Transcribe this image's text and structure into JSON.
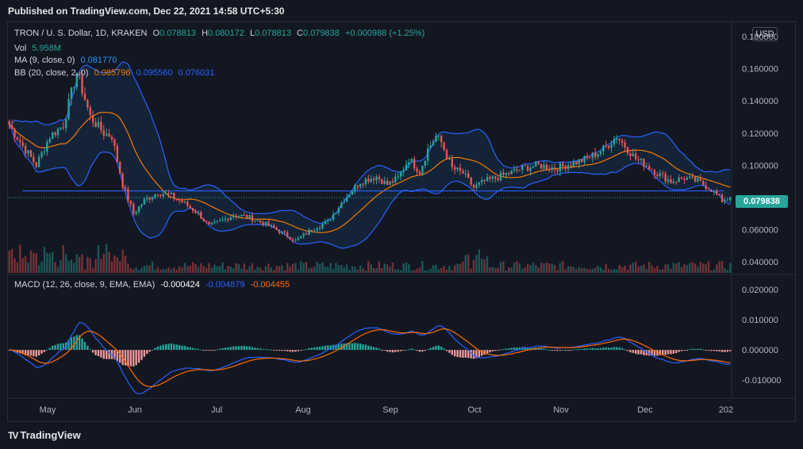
{
  "header": {
    "published": "Published on TradingView.com, Dec 22, 2021 14:58 UTC+5:30"
  },
  "footer": {
    "brand": "TradingView",
    "logo_icon": "TV"
  },
  "legend": {
    "symbol": "TRON / U. S. Dollar, 1D, KRAKEN",
    "o_label": "O",
    "o_val": "0.078813",
    "h_label": "H",
    "h_val": "0.080172",
    "l_label": "L",
    "l_val": "0.078813",
    "c_label": "C",
    "c_val": "0.079838",
    "change": "+0.000988 (+1.25%)",
    "vol_label": "Vol",
    "vol_val": "5.958M",
    "ma_label": "MA (9, close, 0)",
    "ma_val": "0.081770",
    "bb_label": "BB (20, close, 2, 0)",
    "bb_mid": "0.085796",
    "bb_up": "0.095560",
    "bb_low": "0.076031",
    "macd_label": "MACD (12, 26, close, 9, EMA, EMA)",
    "macd_hist": "-0.000424",
    "macd_line": "-0.004879",
    "macd_signal": "-0.004455"
  },
  "currency": "USD",
  "last_price": "0.079838",
  "colors": {
    "up": "#26a69a",
    "down": "#ef5350",
    "bb": "#2962ff",
    "ma": "#f57c00",
    "macd": "#2962ff",
    "signal": "#ff6d00",
    "hline": "#2962ff"
  },
  "chart_data": [
    {
      "type": "candlestick",
      "title": "TRON / U. S. Dollar, 1D, KRAKEN",
      "ylim": [
        0.033,
        0.188
      ],
      "y_ticks": [
        "0.180000",
        "0.160000",
        "0.140000",
        "0.120000",
        "0.100000",
        "0.080000",
        "0.060000",
        "0.040000"
      ],
      "x_ticks": [
        "May",
        "Jun",
        "Jul",
        "Aug",
        "Sep",
        "Oct",
        "Nov",
        "Dec",
        "202"
      ],
      "horizontal_line": 0.084,
      "close_keypoints": [
        {
          "d": 0,
          "v": 0.125
        },
        {
          "d": 5,
          "v": 0.112
        },
        {
          "d": 10,
          "v": 0.1
        },
        {
          "d": 15,
          "v": 0.118
        },
        {
          "d": 20,
          "v": 0.125
        },
        {
          "d": 25,
          "v": 0.158
        },
        {
          "d": 30,
          "v": 0.13
        },
        {
          "d": 35,
          "v": 0.12
        },
        {
          "d": 38,
          "v": 0.118
        },
        {
          "d": 42,
          "v": 0.088
        },
        {
          "d": 46,
          "v": 0.07
        },
        {
          "d": 50,
          "v": 0.078
        },
        {
          "d": 55,
          "v": 0.083
        },
        {
          "d": 60,
          "v": 0.081
        },
        {
          "d": 65,
          "v": 0.076
        },
        {
          "d": 70,
          "v": 0.07
        },
        {
          "d": 74,
          "v": 0.062
        },
        {
          "d": 78,
          "v": 0.065
        },
        {
          "d": 83,
          "v": 0.069
        },
        {
          "d": 88,
          "v": 0.068
        },
        {
          "d": 94,
          "v": 0.064
        },
        {
          "d": 100,
          "v": 0.059
        },
        {
          "d": 106,
          "v": 0.053
        },
        {
          "d": 112,
          "v": 0.06
        },
        {
          "d": 118,
          "v": 0.065
        },
        {
          "d": 124,
          "v": 0.079
        },
        {
          "d": 130,
          "v": 0.09
        },
        {
          "d": 136,
          "v": 0.093
        },
        {
          "d": 140,
          "v": 0.088
        },
        {
          "d": 144,
          "v": 0.092
        },
        {
          "d": 148,
          "v": 0.104
        },
        {
          "d": 152,
          "v": 0.096
        },
        {
          "d": 155,
          "v": 0.11
        },
        {
          "d": 158,
          "v": 0.118
        },
        {
          "d": 160,
          "v": 0.114
        },
        {
          "d": 164,
          "v": 0.098
        },
        {
          "d": 168,
          "v": 0.095
        },
        {
          "d": 172,
          "v": 0.086
        },
        {
          "d": 176,
          "v": 0.09
        },
        {
          "d": 180,
          "v": 0.092
        },
        {
          "d": 185,
          "v": 0.095
        },
        {
          "d": 190,
          "v": 0.098
        },
        {
          "d": 196,
          "v": 0.1
        },
        {
          "d": 202,
          "v": 0.098
        },
        {
          "d": 208,
          "v": 0.101
        },
        {
          "d": 214,
          "v": 0.104
        },
        {
          "d": 220,
          "v": 0.11
        },
        {
          "d": 225,
          "v": 0.118
        },
        {
          "d": 228,
          "v": 0.112
        },
        {
          "d": 232,
          "v": 0.104
        },
        {
          "d": 236,
          "v": 0.1
        },
        {
          "d": 240,
          "v": 0.095
        },
        {
          "d": 245,
          "v": 0.09
        },
        {
          "d": 250,
          "v": 0.092
        },
        {
          "d": 255,
          "v": 0.09
        },
        {
          "d": 260,
          "v": 0.085
        },
        {
          "d": 264,
          "v": 0.078
        },
        {
          "d": 267,
          "v": 0.0798
        }
      ]
    },
    {
      "type": "line",
      "title": "MACD (12, 26, close, 9, EMA, EMA)",
      "ylim": [
        -0.0155,
        0.0245
      ],
      "y_ticks": [
        "0.020000",
        "0.010000",
        "0.000000",
        "-0.010000"
      ]
    }
  ]
}
